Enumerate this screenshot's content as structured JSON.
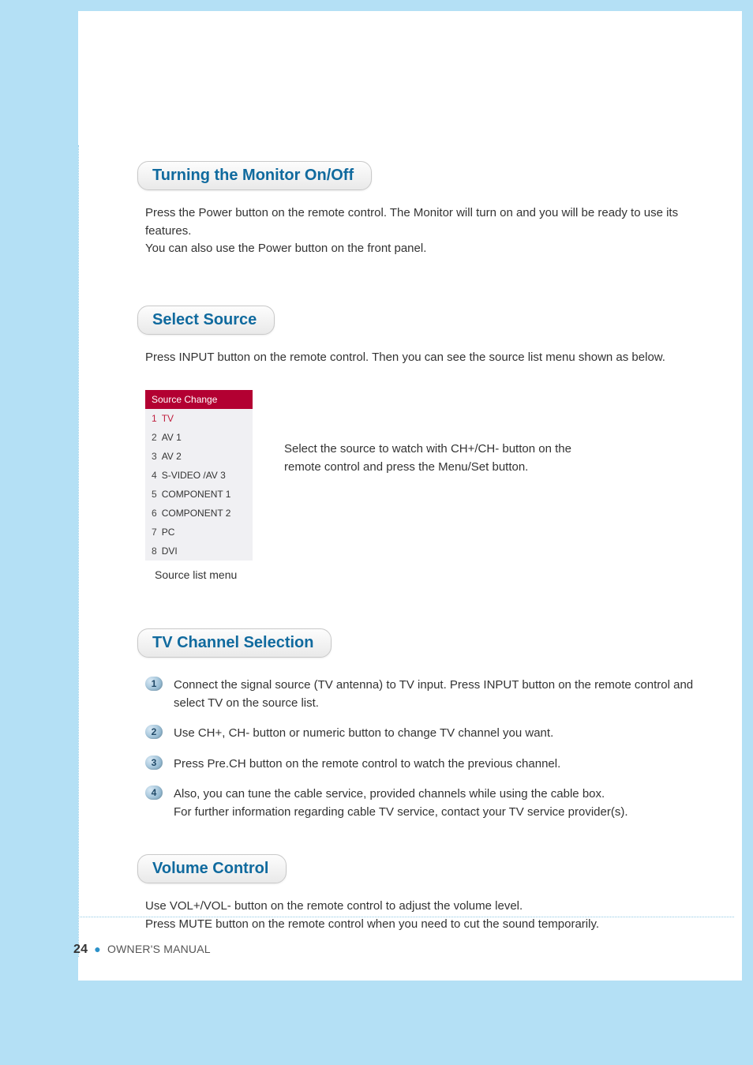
{
  "sections": {
    "s1": {
      "title": "Turning the Monitor On/Off",
      "body": "Press the Power button on the remote control. The Monitor will turn on and you will be ready to use its features.\nYou can also use the Power button on the front panel."
    },
    "s2": {
      "title": "Select Source",
      "intro": "Press INPUT button on the remote control. Then you can see the source list menu shown as below.",
      "source_box": {
        "header": "Source Change",
        "items": [
          {
            "num": "1",
            "label": "TV",
            "selected": true
          },
          {
            "num": "2",
            "label": "AV 1",
            "selected": false
          },
          {
            "num": "3",
            "label": "AV 2",
            "selected": false
          },
          {
            "num": "4",
            "label": "S-VIDEO /AV 3",
            "selected": false
          },
          {
            "num": "5",
            "label": "COMPONENT 1",
            "selected": false
          },
          {
            "num": "6",
            "label": "COMPONENT 2",
            "selected": false
          },
          {
            "num": "7",
            "label": "PC",
            "selected": false
          },
          {
            "num": "8",
            "label": "DVI",
            "selected": false
          }
        ],
        "caption": "Source list menu"
      },
      "desc": "Select the source to watch with CH+/CH- button on the\nremote control and press the Menu/Set button."
    },
    "s3": {
      "title": "TV Channel Selection",
      "steps": [
        {
          "n": "1",
          "text": "Connect the signal source (TV antenna) to TV input. Press INPUT button on the remote control and select TV on the source list."
        },
        {
          "n": "2",
          "text": "Use CH+, CH- button or numeric button to change TV channel you want."
        },
        {
          "n": "3",
          "text": "Press Pre.CH button on the remote control to watch the previous channel."
        },
        {
          "n": "4",
          "text": "Also, you can tune  the cable service, provided channels while using the cable box.\nFor further information regarding cable TV service, contact your TV service provider(s)."
        }
      ]
    },
    "s4": {
      "title": "Volume Control",
      "body": "Use VOL+/VOL- button on the remote control to adjust the volume level.\nPress MUTE button on the remote control when you need to cut the sound temporarily."
    }
  },
  "footer": {
    "page": "24",
    "bullet": "●",
    "label": "OWNER'S MANUAL"
  }
}
